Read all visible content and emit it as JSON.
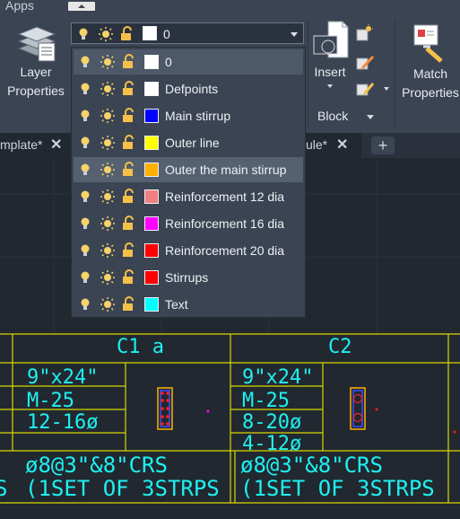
{
  "ribbon": {
    "apps_label": "Apps",
    "layer_properties_label": "Layer\nProperties",
    "insert_label": "Insert",
    "block_label": "Block",
    "match_properties_label": "Match\nProperties"
  },
  "layer_combo": {
    "current_layer": "0",
    "current_color": "#ffffff"
  },
  "layers": [
    {
      "name": "0",
      "color": "#ffffff"
    },
    {
      "name": "Defpoints",
      "color": "#ffffff"
    },
    {
      "name": "Main stirrup",
      "color": "#0000ff"
    },
    {
      "name": "Outer line",
      "color": "#ffff00"
    },
    {
      "name": "Outer the main stirrup",
      "color": "#ffb000"
    },
    {
      "name": "Reinforcement 12 dia",
      "color": "#f08080"
    },
    {
      "name": "Reinforcement 16 dia",
      "color": "#ff00ff"
    },
    {
      "name": "Reinforcement 20 dia",
      "color": "#ff0000"
    },
    {
      "name": "Stirrups",
      "color": "#ff0000"
    },
    {
      "name": "Text",
      "color": "#00ffff"
    }
  ],
  "tabs": {
    "left_tab": "mplate*",
    "right_tab": "ule*",
    "close_glyph": "✕",
    "new_tab_glyph": "+"
  },
  "drawing": {
    "c1_title": "C1  a",
    "c2_title": "C2",
    "c1_size": "9\"x24\"",
    "c1_grade": "M-25",
    "c1_bars": "12-16ø",
    "c2_size": "9\"x24\"",
    "c2_grade": "M-25",
    "c2_bars1": "8-20ø",
    "c2_bars2": "4-12ø",
    "c1_stirrup1": "ø8@3\"&8\"CRS",
    "c1_stirrup2": "(1SET OF 3STRPS",
    "c2_stirrup1": "ø8@3\"&8\"CRS",
    "c2_stirrup2": "(1SET OF 3STRPS",
    "left_fragment": "S",
    "colors": {
      "text": "#1ff0f0",
      "grid": "#ffff00"
    }
  }
}
